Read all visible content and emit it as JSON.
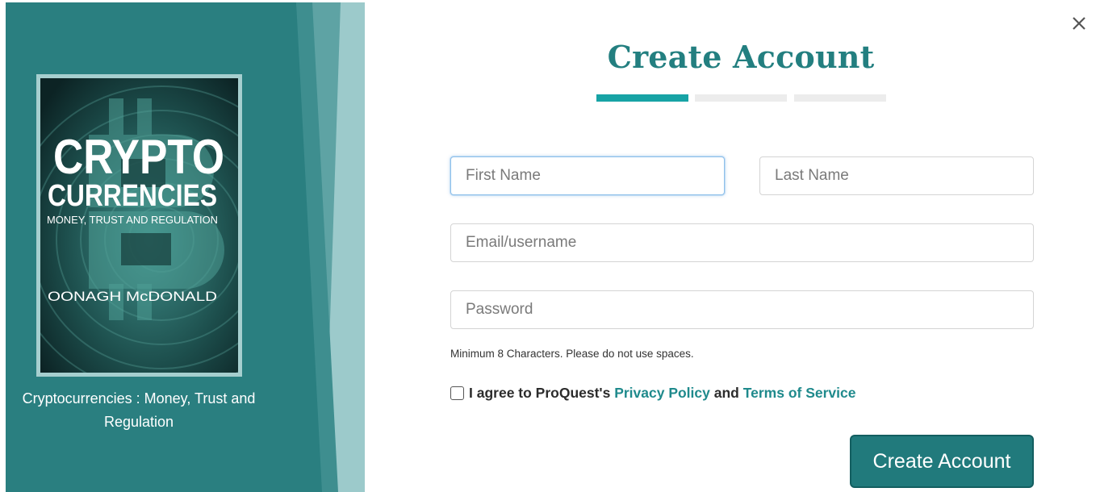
{
  "sidebar": {
    "cover": {
      "title_line1": "CRYPTO",
      "title_line2": "CURRENCIES",
      "subtitle": "MONEY, TRUST AND REGULATION",
      "author": "OONAGH McDONALD"
    },
    "book_title": "Cryptocurrencies : Money, Trust and Regulation"
  },
  "dialog": {
    "close_icon": "close-icon",
    "heading": "Create Account",
    "steps": {
      "total": 3,
      "current": 1
    },
    "form": {
      "first_name": {
        "value": "",
        "placeholder": "First Name"
      },
      "last_name": {
        "value": "",
        "placeholder": "Last Name"
      },
      "email": {
        "value": "",
        "placeholder": "Email/username"
      },
      "password": {
        "value": "",
        "placeholder": "Password"
      },
      "password_hint": "Minimum 8 Characters. Please do not use spaces.",
      "agree": {
        "checked": false,
        "prefix": "I agree to ProQuest's ",
        "privacy_link": "Privacy Policy",
        "middle": " and ",
        "terms_link": "Terms of Service"
      },
      "submit_label": "Create Account"
    }
  },
  "colors": {
    "teal_panel": "#2a7f80",
    "accent": "#17a3a5",
    "heading": "#237f80",
    "button": "#217a7c",
    "link": "#1f8a8c"
  }
}
